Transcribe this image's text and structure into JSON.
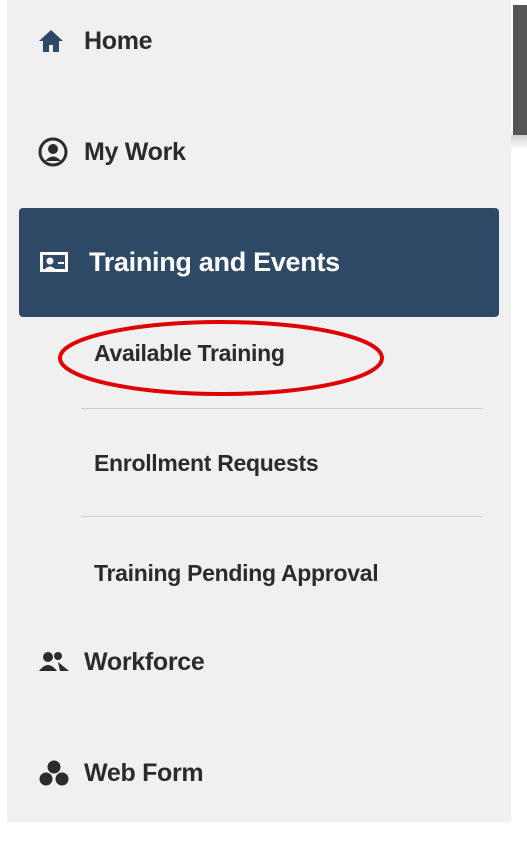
{
  "nav": {
    "home": {
      "label": "Home",
      "icon": "home-icon"
    },
    "my_work": {
      "label": "My Work",
      "icon": "user-circle-icon"
    },
    "training_and_events": {
      "label": "Training and Events",
      "icon": "training-board-icon",
      "active": true,
      "sub_items": [
        {
          "label": "Available Training",
          "highlighted": true
        },
        {
          "label": "Enrollment Requests"
        },
        {
          "label": "Training Pending Approval"
        }
      ]
    },
    "workforce": {
      "label": "Workforce",
      "icon": "people-icon"
    },
    "web_form": {
      "label": "Web Form",
      "icon": "cubes-icon"
    }
  },
  "colors": {
    "active_background": "#2e4966",
    "sidebar_background": "#f0f0f0",
    "highlight_annotation": "#e00000",
    "text": "#2b2b2b"
  }
}
